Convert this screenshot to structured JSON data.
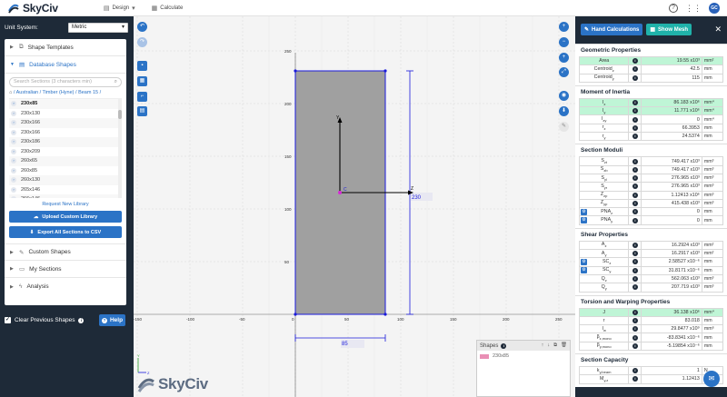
{
  "app": {
    "brand": "SkyCiv",
    "user_initials": "GC"
  },
  "topnav": {
    "design": "Design",
    "calculate": "Calculate"
  },
  "left": {
    "unit_label": "Unit System:",
    "unit_value": "Metric",
    "shape_templates": "Shape Templates",
    "database_shapes": "Database Shapes",
    "search_placeholder": "Search Sections (3 characters min)",
    "breadcrumb": "/ Australian / Timber (Hyne) / Beam 15 /",
    "sections": [
      "230x85",
      "230x130",
      "230x166",
      "230x166",
      "230x186",
      "230x209",
      "260x65",
      "260x85",
      "260x130",
      "265x146",
      "266x146"
    ],
    "request_link": "Request New Library",
    "upload_btn": "Upload Custom Library",
    "export_btn": "Export All Sections to CSV",
    "custom_shapes": "Custom Shapes",
    "my_sections": "My Sections",
    "analysis": "Analysis",
    "clear_prev": "Clear Previous Shapes",
    "help": "Help"
  },
  "canvas": {
    "x_ticks": [
      "-150",
      "-100",
      "-50",
      "0",
      "50",
      "100",
      "150",
      "200",
      "250"
    ],
    "y_ticks": [
      "250",
      "200",
      "150",
      "100",
      "50"
    ],
    "y_axis_label": "Y",
    "z_axis_label": "Z",
    "centroid_label": "C",
    "width_dim": "85",
    "height_dim": "230",
    "shapes_panel_title": "Shapes",
    "shape_name": "230x85",
    "watermark": "SkyCiv",
    "colors": {
      "section_fill": "#a0a0a0",
      "edge": "#1a1adb",
      "centroid": "#d62ad6",
      "swatch": "#e98fb5"
    }
  },
  "right": {
    "hand_calc": "Hand Calculations",
    "show_mesh": "Show Mesh",
    "sections": [
      {
        "title": "Geometric Properties",
        "rows": [
          {
            "label": "Area",
            "value": "19.55 x10³",
            "unit": "mm²",
            "hl": true
          },
          {
            "label": "Centroid_z",
            "value": "42.5",
            "unit": "mm"
          },
          {
            "label": "Centroid_y",
            "value": "115",
            "unit": "mm"
          }
        ]
      },
      {
        "title": "Moment of Inertia",
        "rows": [
          {
            "label": "I_z",
            "value": "86.183 x10⁶",
            "unit": "mm⁴",
            "hl": true
          },
          {
            "label": "I_y",
            "value": "11.771 x10⁶",
            "unit": "mm⁴",
            "hl": true
          },
          {
            "label": "I_zy",
            "value": "0",
            "unit": "mm⁴"
          },
          {
            "label": "r_z",
            "value": "66.3953",
            "unit": "mm"
          },
          {
            "label": "r_y",
            "value": "24.5374",
            "unit": "mm"
          }
        ]
      },
      {
        "title": "Section Moduli",
        "rows": [
          {
            "label": "S_zt",
            "value": "749.417 x10³",
            "unit": "mm³"
          },
          {
            "label": "S_zb",
            "value": "749.417 x10³",
            "unit": "mm³"
          },
          {
            "label": "S_yl",
            "value": "276.965 x10³",
            "unit": "mm³"
          },
          {
            "label": "S_yr",
            "value": "276.965 x10³",
            "unit": "mm³"
          },
          {
            "label": "Z_zp",
            "value": "1.12413 x10⁶",
            "unit": "mm³"
          },
          {
            "label": "Z_yp",
            "value": "415.438 x10³",
            "unit": "mm³"
          },
          {
            "label": "PNA_z",
            "value": "0",
            "unit": "mm",
            "gear": true
          },
          {
            "label": "PNA_y",
            "value": "0",
            "unit": "mm",
            "gear": true
          }
        ]
      },
      {
        "title": "Shear Properties",
        "rows": [
          {
            "label": "A_z",
            "value": "16.2924 x10³",
            "unit": "mm²"
          },
          {
            "label": "A_y",
            "value": "16.2917 x10³",
            "unit": "mm²"
          },
          {
            "label": "SC_z",
            "value": "2.58527 x10⁻⁶",
            "unit": "mm",
            "gear": true
          },
          {
            "label": "SC_y",
            "value": "31.8171 x10⁻⁶",
            "unit": "mm",
            "gear": true
          },
          {
            "label": "Q_z",
            "value": "562.063 x10³",
            "unit": "mm³"
          },
          {
            "label": "Q_y",
            "value": "207.719 x10³",
            "unit": "mm³"
          }
        ]
      },
      {
        "title": "Torsion and Warping Properties",
        "rows": [
          {
            "label": "J",
            "value": "36.138 x10⁶",
            "unit": "mm⁴",
            "hl": true
          },
          {
            "label": "r",
            "value": "83.018",
            "unit": "mm"
          },
          {
            "label": "I_w",
            "value": "29.8477 x10⁹",
            "unit": "mm⁶"
          },
          {
            "label": "β_z,mono",
            "value": "-83.8341 x10⁻⁶",
            "unit": "mm"
          },
          {
            "label": "β_y,mono",
            "value": "-5.19854 x10⁻⁶",
            "unit": "mm"
          }
        ]
      },
      {
        "title": "Section Capacity",
        "rows": [
          {
            "label": "k_y,beam",
            "value": "1",
            "unit": "N"
          },
          {
            "label": "M_y,z",
            "value": "1.12413",
            "unit": "kN·m"
          }
        ]
      }
    ]
  }
}
